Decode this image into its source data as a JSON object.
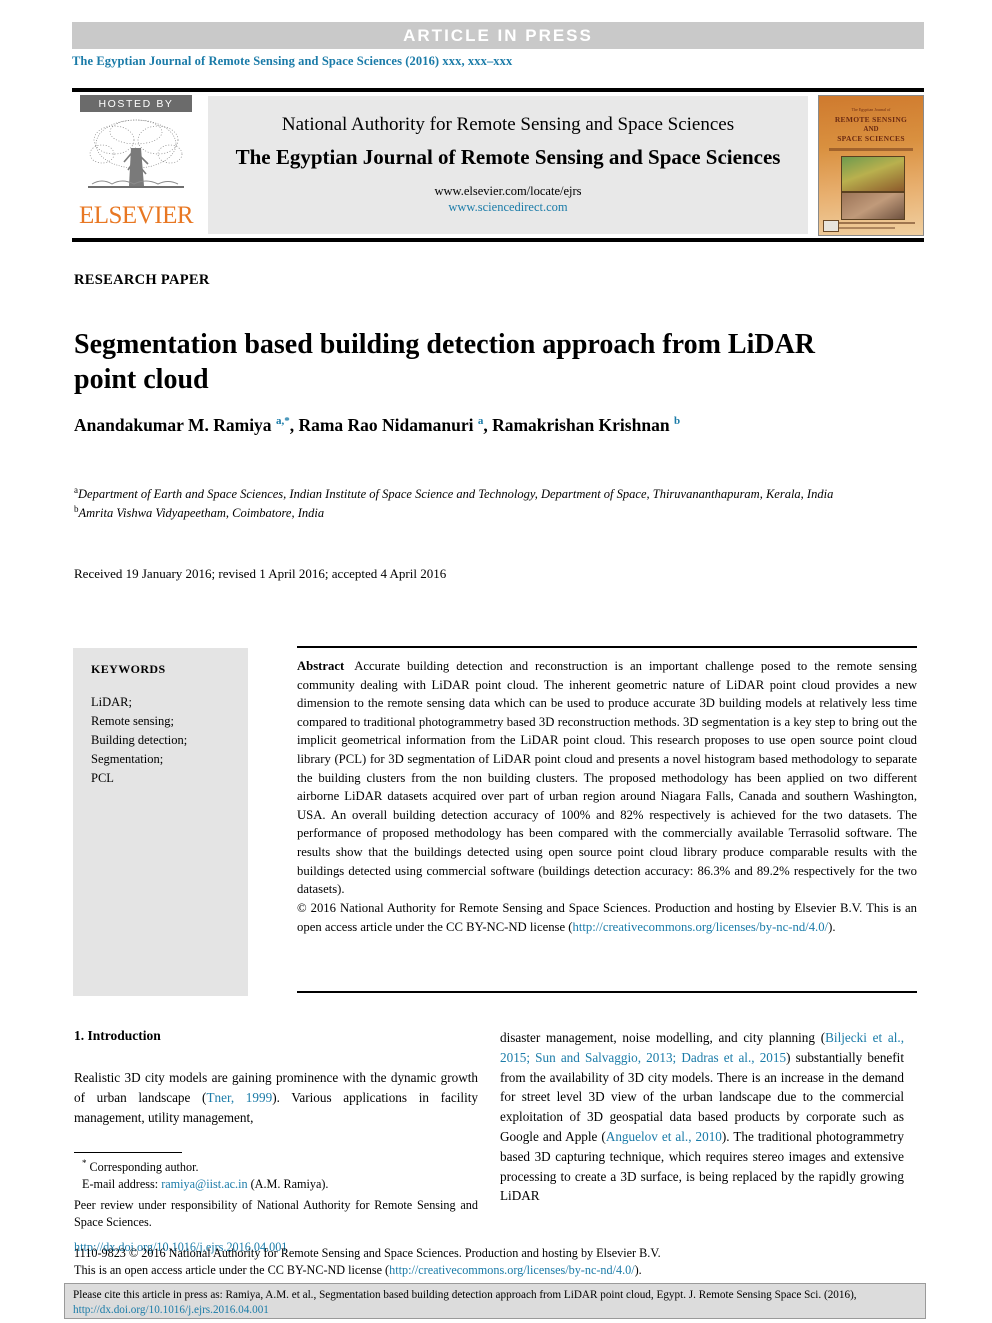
{
  "banner": {
    "text": "ARTICLE  IN  PRESS"
  },
  "running_head": "The Egyptian Journal of Remote Sensing and Space Sciences (2016) xxx, xxx–xxx",
  "masthead": {
    "hosted_by": "HOSTED BY",
    "publisher_wordmark": "ELSEVIER",
    "organization": "National Authority for Remote Sensing and Space Sciences",
    "journal_title": "The Egyptian Journal of Remote Sensing and Space Sciences",
    "url_elsevier": "www.elsevier.com/locate/ejrs",
    "url_sciencedirect": "www.sciencedirect.com",
    "cover": {
      "line1": "The Egyptian Journal of",
      "line2": "REMOTE SENSING",
      "line3": "AND",
      "line4": "SPACE SCIENCES"
    }
  },
  "article": {
    "type": "RESEARCH PAPER",
    "title": "Segmentation based building detection approach from LiDAR point cloud",
    "authors_html": "Anandakumar M. Ramiya <sup>a,*</sup>, Rama Rao Nidamanuri <sup>a</sup>, Ramakrishan Krishnan <sup>b</sup>",
    "affiliation_a": "Department of Earth and Space Sciences, Indian Institute of Space Science and Technology, Department of Space, Thiruvananthapuram, Kerala, India",
    "affiliation_b": "Amrita Vishwa Vidyapeetham, Coimbatore, India",
    "history": "Received 19 January 2016; revised 1 April 2016; accepted 4 April 2016"
  },
  "keywords": {
    "heading": "KEYWORDS",
    "items": [
      "LiDAR;",
      "Remote sensing;",
      "Building detection;",
      "Segmentation;",
      "PCL"
    ]
  },
  "abstract": {
    "label": "Abstract",
    "text": "Accurate building detection and reconstruction is an important challenge posed to the remote sensing community dealing with LiDAR point cloud. The inherent geometric nature of LiDAR point cloud provides a new dimension to the remote sensing data which can be used to produce accurate 3D building models at relatively less time compared to traditional photogrammetry based 3D reconstruction methods. 3D segmentation is a key step to bring out the implicit geometrical information from the LiDAR point cloud. This research proposes to use open source point cloud library (PCL) for 3D segmentation of LiDAR point cloud and presents a novel histogram based methodology to separate the building clusters from the non building clusters. The proposed methodology has been applied on two different airborne LiDAR datasets acquired over part of urban region around Niagara Falls, Canada and southern Washington, USA. An overall building detection accuracy of 100% and 82% respectively is achieved for the two datasets. The performance of proposed methodology has been compared with the commercially available Terrasolid software. The results show that the buildings detected using open source point cloud library produce comparable results with the buildings detected using commercial software (buildings detection accuracy: 86.3% and 89.2% respectively for the two datasets).",
    "copyright_text": "© 2016 National Authority for Remote Sensing and Space Sciences. Production and hosting by Elsevier B.V.   This is an open access article under the CC BY-NC-ND license (",
    "license_url": "http://creativecommons.org/licenses/by-nc-nd/4.0/",
    "copyright_tail": ")."
  },
  "introduction": {
    "heading": "1. Introduction",
    "left_par_1": "Realistic 3D city models are gaining prominence with the dynamic growth of urban landscape (",
    "left_cite_1": "Tner, 1999",
    "left_par_2": "). Various applications in facility management, utility management,",
    "right_par_1": "disaster management, noise modelling, and city planning (",
    "right_cite_1": "Biljecki et al., 2015; Sun and Salvaggio, 2013; Dadras et al., 2015",
    "right_par_2": ") substantially benefit from the availability of 3D city models. There is an increase in the demand for street level 3D view of the urban landscape due to the commercial exploitation of 3D geospatial data based products by corporate such as Google and Apple (",
    "right_cite_2": "Anguelov et al., 2010",
    "right_par_3": "). The traditional photogrammetry based 3D capturing technique, which requires stereo images and extensive processing to create a 3D surface, is being replaced by the rapidly growing LiDAR"
  },
  "footnotes": {
    "corresponding": "Corresponding author.",
    "email_label": "E-mail address:",
    "email": "ramiya@iist.ac.in",
    "email_owner": "(A.M. Ramiya).",
    "peer_review": "Peer review under responsibility of National Authority for Remote Sensing and Space Sciences.",
    "doi": "http://dx.doi.org/10.1016/j.ejrs.2016.04.001"
  },
  "license_strip": {
    "line1": "1110-9823 © 2016 National Authority for Remote Sensing and Space Sciences. Production and hosting by Elsevier B.V.",
    "line2_pre": "This is an open access article under the CC BY-NC-ND license (",
    "line2_url": "http://creativecommons.org/licenses/by-nc-nd/4.0/",
    "line2_post": ")."
  },
  "cite_box": {
    "text_pre": "Please cite this article in press as: Ramiya, A.M. et al., Segmentation based building detection approach from LiDAR point cloud, Egypt. J. Remote Sensing Space Sci. (2016), ",
    "url": "http://dx.doi.org/10.1016/j.ejrs.2016.04.001"
  },
  "colors": {
    "link": "#1a7ba8",
    "elsevier_orange": "#e87722",
    "banner_bg": "#c9c9c9",
    "keyword_bg": "#e4e4e4",
    "masthead_bg": "#e8e8e8"
  }
}
